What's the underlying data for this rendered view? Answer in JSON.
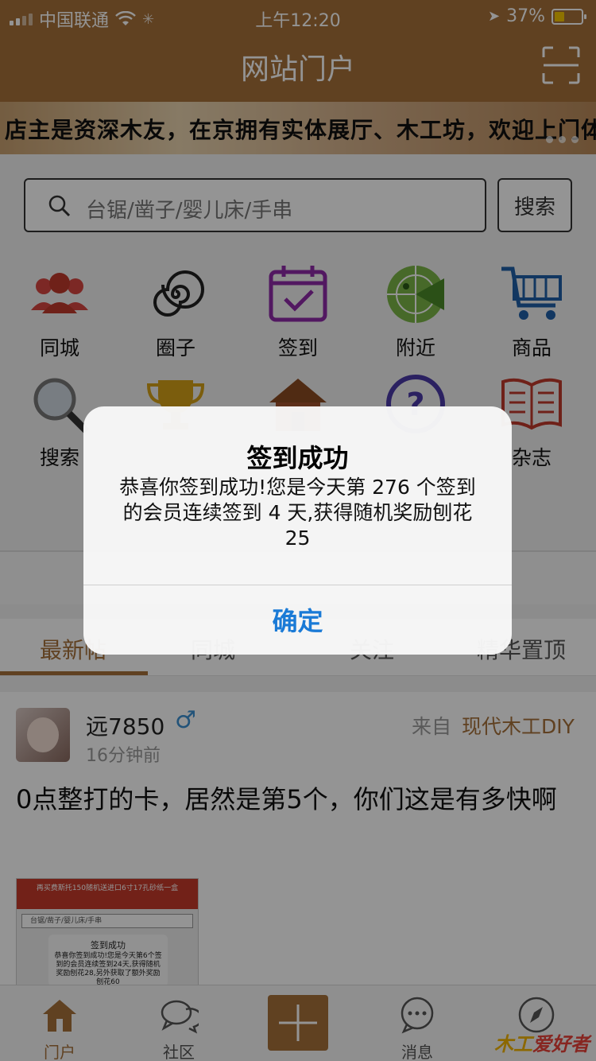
{
  "status_bar": {
    "carrier": "中国联通",
    "time": "上午12:20",
    "battery_percent": "37%",
    "battery_level": 0.37
  },
  "nav": {
    "title": "网站门户",
    "scan_icon": "scan-icon"
  },
  "banner": {
    "text": "店主是资深木友，在京拥有实体展厅、木工坊，欢迎上门体验。"
  },
  "search": {
    "placeholder": "台锯/凿子/婴儿床/手串",
    "button": "搜索"
  },
  "grid": {
    "row1": [
      {
        "label": "同城",
        "icon": "users-icon"
      },
      {
        "label": "圈子",
        "icon": "spiral-icon"
      },
      {
        "label": "签到",
        "icon": "calendar-check-icon"
      },
      {
        "label": "附近",
        "icon": "radar-icon"
      },
      {
        "label": "商品",
        "icon": "cart-icon"
      }
    ],
    "row2": [
      {
        "label": "搜索",
        "icon": "magnifier-icon"
      },
      {
        "label": "",
        "icon": "trophy-icon"
      },
      {
        "label": "",
        "icon": "house-icon"
      },
      {
        "label": "",
        "icon": "question-icon"
      },
      {
        "label": "杂志",
        "icon": "book-icon"
      }
    ]
  },
  "tabs": [
    {
      "label": "最新帖"
    },
    {
      "label": "同城"
    },
    {
      "label": "关注"
    },
    {
      "label": "精华置顶"
    }
  ],
  "post": {
    "username": "远7850",
    "gender_symbol": "♂",
    "time_ago": "16分钟前",
    "from_label": "来自",
    "from_value": "现代木工DIY",
    "text": "0点整打的卡，居然是第5个，你们这是有多快啊",
    "thumb": {
      "banner_text": "再买费斯托150随机送进口6寸17孔砂纸一盒",
      "search_text": "台锯/凿子/婴儿床/手串",
      "dialog_title": "签到成功",
      "dialog_text": "恭喜你签到成功!您是今天第6个签到的会员连续签到24天,获得随机奖励刨花28,另外获取了额外奖励刨花60"
    }
  },
  "bottom_nav": [
    {
      "label": "门户",
      "icon": "home-icon",
      "active": true
    },
    {
      "label": "社区",
      "icon": "chat-icon",
      "active": false
    },
    {
      "label": "",
      "icon": "plus-icon",
      "active": false
    },
    {
      "label": "消息",
      "icon": "message-icon",
      "active": false
    },
    {
      "label": "",
      "icon": "compass-icon",
      "active": false
    }
  ],
  "watermark": {
    "part_a": "木工",
    "part_b": "爱好者"
  },
  "dialog": {
    "title": "签到成功",
    "message": "恭喜你签到成功!您是今天第 276 个签到的会员连续签到 4 天,获得随机奖励刨花 25",
    "ok_button": "确定"
  },
  "colors": {
    "brand": "#a5703a",
    "link_blue": "#1a7ad6"
  }
}
